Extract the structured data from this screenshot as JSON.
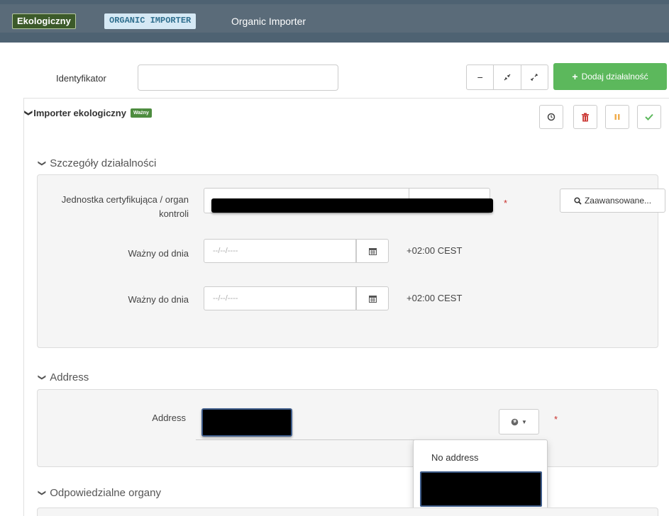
{
  "header": {
    "category_badge": "Ekologiczny",
    "code_badge": "ORGANIC IMPORTER",
    "title": "Organic Importer"
  },
  "identifier": {
    "label": "Identyfikator",
    "value": ""
  },
  "toolbar": {
    "collapse_icon": "minus-icon",
    "compress_icon": "compress-icon",
    "expand_icon": "expand-icon",
    "add_activity_label": "Dodaj działalność"
  },
  "activity": {
    "title": "Importer ekologiczny",
    "status_badge": "Ważny",
    "actions": [
      "history-icon",
      "trash-icon",
      "pause-icon",
      "check-icon"
    ]
  },
  "details": {
    "section_title": "Szczegóły działalności",
    "certifying_body_label": "Jednostka certyfikująca / organ kontroli",
    "required_mark": "*",
    "advanced_button": "Zaawansowane...",
    "valid_from_label": "Ważny od dnia",
    "valid_to_label": "Ważny do dnia",
    "date_placeholder": "--/--/----",
    "timezone": "+02:00 CEST"
  },
  "address": {
    "section_title": "Address",
    "label": "Address",
    "required_mark": "*",
    "dropdown_options": [
      "No address"
    ]
  },
  "authorities": {
    "section_title": "Odpowiedzialne organy"
  },
  "colors": {
    "header_bg": "#4e6272",
    "success": "#5cb85c",
    "danger": "#c9302c",
    "warning": "#f0ad4e"
  }
}
